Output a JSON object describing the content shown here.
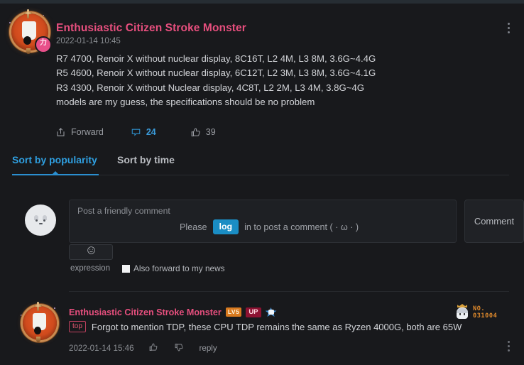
{
  "post": {
    "username": "Enthusiastic Citizen Stroke Monster",
    "timestamp": "2022-01-14 10:45",
    "lines": [
      "R7 4700, Renoir X without nuclear display, 8C16T, L2 4M, L3 8M, 3.6G~4.4G",
      "R5 4600, Renoir X without nuclear display, 6C12T, L2 3M, L3 8M, 3.6G~4.1G",
      "R3 4300, Renoir X without Nuclear display, 4C8T, L2 2M, L3 4M, 3.8G~4G",
      "models are my guess, the specifications should be no problem"
    ],
    "avatar_badge": "forward-icon",
    "actions": {
      "forward_label": "Forward",
      "comment_count": "24",
      "like_count": "39"
    }
  },
  "tabs": [
    {
      "label": "Sort by popularity",
      "active": true
    },
    {
      "label": "Sort by time",
      "active": false
    }
  ],
  "composer": {
    "placeholder": "Post a friendly comment",
    "login_prefix": "Please",
    "login_button": "log",
    "login_suffix": "in to post a comment ( · ω · )",
    "submit_label": "Comment",
    "expression_label": "expression",
    "forward_checkbox_label": "Also forward to my news",
    "forward_checkbox_checked": false
  },
  "comments": [
    {
      "username": "Enthusiastic Citizen Stroke Monster",
      "level_badge": "LV5",
      "up_badge": "UP",
      "top_badge": "top",
      "text": "Forgot to mention TDP, these CPU TDP remains the same as Ryzen 4000G, both are 65W",
      "timestamp": "2022-01-14 15:46",
      "reply_label": "reply",
      "no_badge_line1": "NO.",
      "no_badge_line2": "031004"
    }
  ],
  "colors": {
    "background": "#18191c",
    "top_strip": "#262d33",
    "username_pink": "#e74f7e",
    "tab_active_blue": "#2f9fe0",
    "login_button_blue": "#1a8dc4",
    "comment_count_blue": "#3a9ad9",
    "badge_level_orange": "#d87a1f",
    "badge_up_crimson": "#8d1232",
    "no_badge_gold": "#e08a2c"
  }
}
